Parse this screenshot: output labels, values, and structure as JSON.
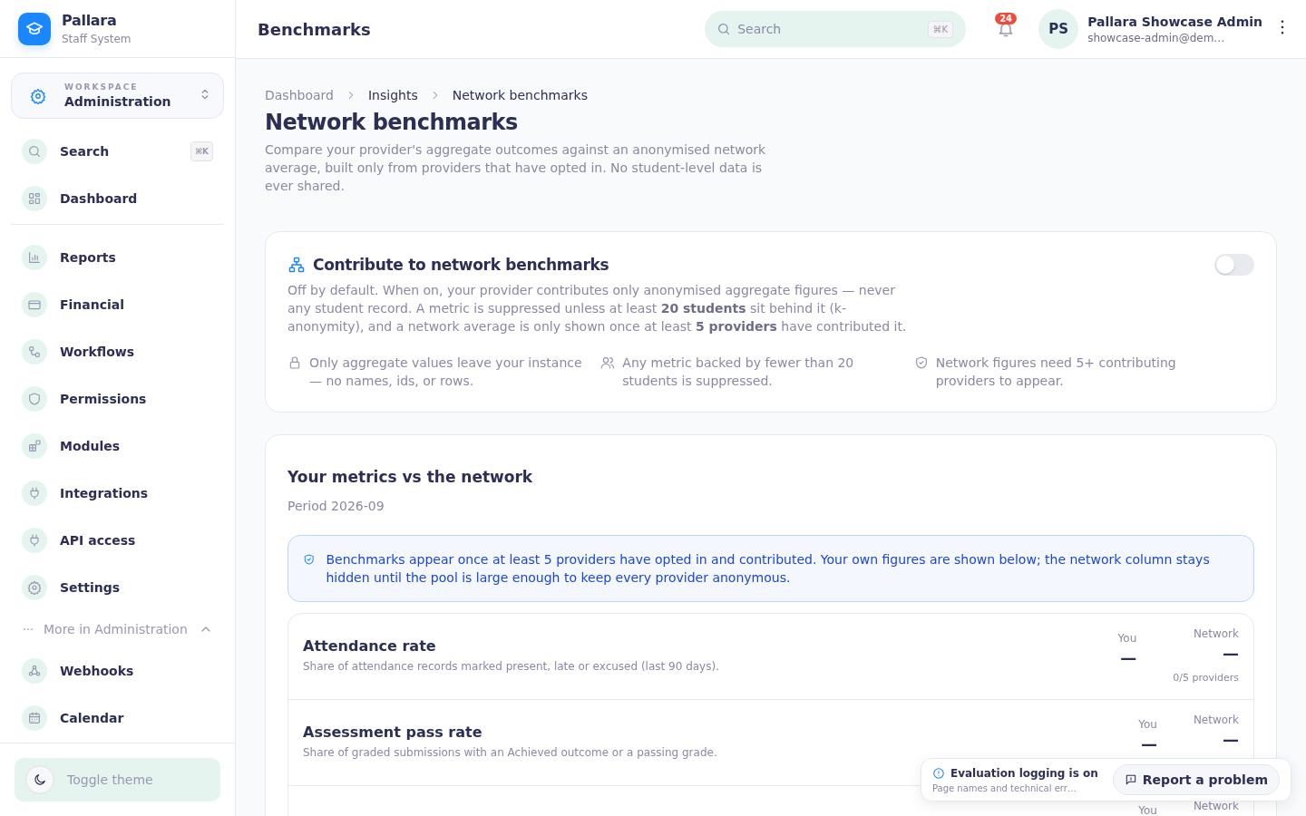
{
  "sidebar": {
    "brand": {
      "name": "Pallara",
      "subtitle": "Staff System"
    },
    "workspace": {
      "label": "WORKSPACE",
      "value": "Administration"
    },
    "nav_groups": [
      [
        {
          "label": "Search",
          "shortcut": "⌘K"
        },
        {
          "label": "Dashboard"
        }
      ],
      [
        {
          "label": "Reports"
        },
        {
          "label": "Financial"
        },
        {
          "label": "Workflows"
        },
        {
          "label": "Permissions"
        },
        {
          "label": "Modules"
        },
        {
          "label": "Integrations"
        },
        {
          "label": "API access"
        },
        {
          "label": "Settings"
        }
      ]
    ],
    "more": {
      "label": "More in Administration",
      "expanded": true
    },
    "more_items": [
      {
        "label": "Webhooks"
      },
      {
        "label": "Calendar"
      }
    ],
    "theme_toggle": "Toggle theme"
  },
  "header": {
    "title": "Benchmarks",
    "search": {
      "placeholder": "Search",
      "shortcut": "⌘K"
    },
    "notifications": "24",
    "user": {
      "initials": "PS",
      "name": "Pallara Showcase Admin",
      "email": "showcase-admin@dem…"
    }
  },
  "breadcrumb": [
    {
      "label": "Dashboard"
    },
    {
      "label": "Insights"
    },
    {
      "label": "Network benchmarks"
    }
  ],
  "page": {
    "title": "Network benchmarks",
    "description": "Compare your provider's aggregate outcomes against an anonymised network average, built only from providers that have opted in. No student-level data is ever shared."
  },
  "contribute": {
    "title": "Contribute to network benchmarks",
    "on": false,
    "description": "Off by default. When on, your provider contributes only anonymised aggregate figures — never any student record. A metric is suppressed unless at least **20 students** sit behind it (k-anonymity), and a network average is only shown once at least **5 providers** have contributed it.",
    "points": [
      "Only aggregate values leave your instance — no names, ids, or rows.",
      "Any metric backed by fewer than 20 students is suppressed.",
      "Network figures need 5+ contributing providers to appear."
    ]
  },
  "metrics": {
    "title": "Your metrics vs the network",
    "period": "Period 2026-09",
    "notice": "Benchmarks appear once at least 5 providers have opted in and contributed. Your own figures are shown below; the network column stays hidden until the pool is large enough to keep every provider anonymous.",
    "rows": [
      {
        "name": "Attendance rate",
        "description": "Share of attendance records marked present, late or excused (last 90 days).",
        "you_label": "You",
        "you_value": "—",
        "network_label": "Network",
        "network_value": "—",
        "network_note": "0/5 providers"
      },
      {
        "name": "Assessment pass rate",
        "description": "Share of graded submissions with an Achieved outcome or a passing grade.",
        "you_label": "You",
        "you_value": "—",
        "network_label": "Network",
        "network_value": "—"
      },
      {
        "you_label": "You",
        "network_label": "Network"
      }
    ]
  },
  "toast": {
    "title": "Evaluation logging is on",
    "text": "Page names and technical err…",
    "button": "Report a problem"
  }
}
